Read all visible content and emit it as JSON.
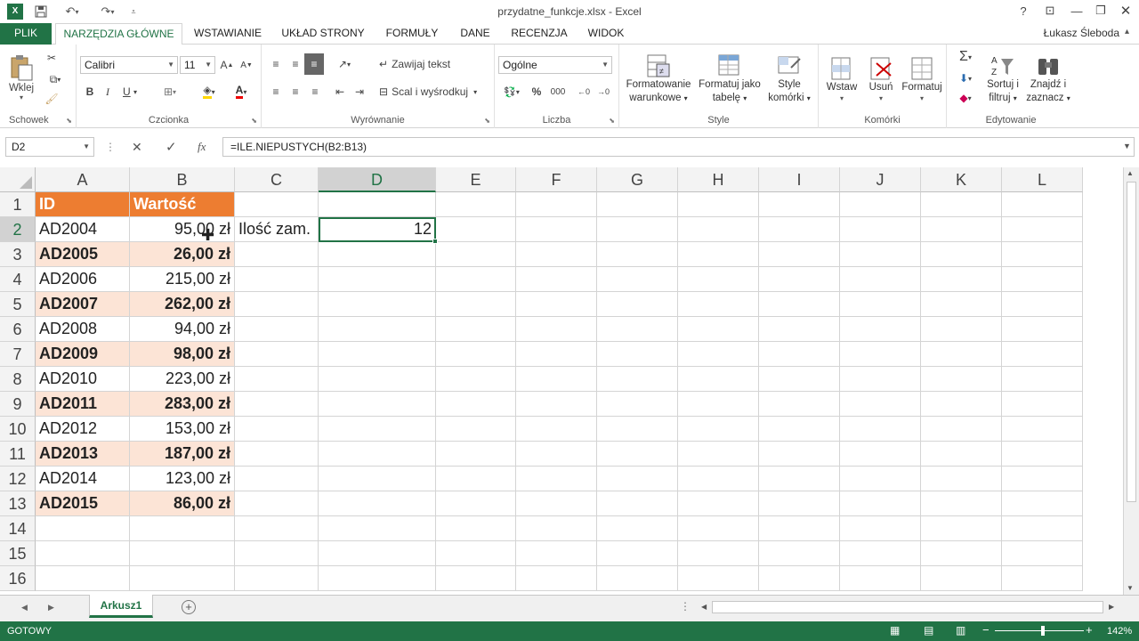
{
  "window": {
    "title": "przydatne_funkcje.xlsx - Excel"
  },
  "tabs": [
    {
      "label": "PLIK"
    },
    {
      "label": "NARZĘDZIA GŁÓWNE"
    },
    {
      "label": "WSTAWIANIE"
    },
    {
      "label": "UKŁAD STRONY"
    },
    {
      "label": "FORMUŁY"
    },
    {
      "label": "DANE"
    },
    {
      "label": "RECENZJA"
    },
    {
      "label": "WIDOK"
    }
  ],
  "user": "Łukasz Śleboda",
  "ribbon": {
    "clipboard": {
      "label": "Schowek",
      "paste": "Wklej"
    },
    "font": {
      "label": "Czcionka",
      "name": "Calibri",
      "size": "11",
      "bold": "B",
      "italic": "I",
      "underline": "U"
    },
    "alignment": {
      "label": "Wyrównanie",
      "wrap": "Zawijaj tekst",
      "merge": "Scal i wyśrodkuj"
    },
    "number": {
      "label": "Liczba",
      "format": "Ogólne"
    },
    "styles": {
      "label": "Style",
      "conditional": [
        "Formatowanie",
        "warunkowe"
      ],
      "table": [
        "Formatuj jako",
        "tabelę"
      ],
      "cell": [
        "Style",
        "komórki"
      ]
    },
    "cells": {
      "label": "Komórki",
      "insert": "Wstaw",
      "delete": "Usuń",
      "format": "Formatuj"
    },
    "editing": {
      "label": "Edytowanie",
      "sort": [
        "Sortuj i",
        "filtruj"
      ],
      "find": [
        "Znajdź i",
        "zaznacz"
      ]
    }
  },
  "formula_bar": {
    "name_box": "D2",
    "formula": "=ILE.NIEPUSTYCH(B2:B13)",
    "fx": "fx"
  },
  "columns": [
    "A",
    "B",
    "C",
    "D",
    "E",
    "F",
    "G",
    "H",
    "I",
    "J",
    "K",
    "L"
  ],
  "rows": [
    "1",
    "2",
    "3",
    "4",
    "5",
    "6",
    "7",
    "8",
    "9",
    "10",
    "11",
    "12",
    "13",
    "14",
    "15",
    "16"
  ],
  "table": {
    "header": {
      "id": "ID",
      "value": "Wartość"
    },
    "rows": [
      {
        "id": "AD2004",
        "value": "95,00 zł"
      },
      {
        "id": "AD2005",
        "value": "26,00 zł"
      },
      {
        "id": "AD2006",
        "value": "215,00 zł"
      },
      {
        "id": "AD2007",
        "value": "262,00 zł"
      },
      {
        "id": "AD2008",
        "value": "94,00 zł"
      },
      {
        "id": "AD2009",
        "value": "98,00 zł"
      },
      {
        "id": "AD2010",
        "value": "223,00 zł"
      },
      {
        "id": "AD2011",
        "value": "283,00 zł"
      },
      {
        "id": "AD2012",
        "value": "153,00 zł"
      },
      {
        "id": "AD2013",
        "value": "187,00 zł"
      },
      {
        "id": "AD2014",
        "value": "123,00 zł"
      },
      {
        "id": "AD2015",
        "value": "86,00 zł"
      }
    ]
  },
  "cells": {
    "c2": "Ilość zam.",
    "d2": "12"
  },
  "sheet_tab": "Arkusz1",
  "status": {
    "ready": "GOTOWY",
    "zoom": "142%"
  },
  "colors": {
    "accent": "#217346",
    "header_fill": "#ed7d31",
    "band_fill": "#fce4d6"
  }
}
